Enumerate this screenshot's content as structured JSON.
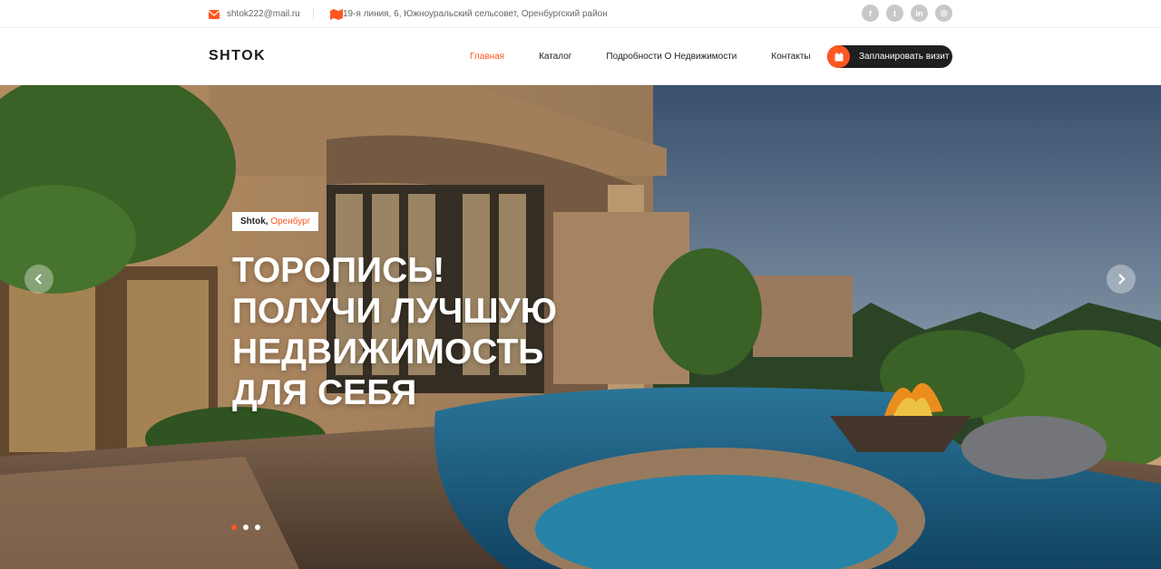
{
  "topbar": {
    "email": "shtok222@mail.ru",
    "address": "19-я линия, 6, Южноуральский сельсовет, Оренбургский район",
    "socials": [
      "facebook-icon",
      "twitter-icon",
      "linkedin-icon",
      "instagram-icon"
    ]
  },
  "nav": {
    "logo": "SHTOK",
    "items": [
      {
        "label": "Главная",
        "active": true
      },
      {
        "label": "Каталог",
        "active": false
      },
      {
        "label": "Подробности О Недвижимости",
        "active": false
      },
      {
        "label": "Контакты",
        "active": false
      }
    ],
    "cta": "Запланировать визит"
  },
  "hero": {
    "tag_brand": "Shtok",
    "tag_sep": ", ",
    "tag_city": "Оренбург",
    "headline": [
      "ТОРОПИСЬ!",
      "ПОЛУЧИ ЛУЧШУЮ",
      "НЕДВИЖИМОСТЬ",
      "ДЛЯ СЕБЯ"
    ],
    "slides_total": 3,
    "slide_active": 1
  },
  "colors": {
    "accent": "#ff5722",
    "dark": "#1f1f1f",
    "muted": "#c8c8c8"
  }
}
